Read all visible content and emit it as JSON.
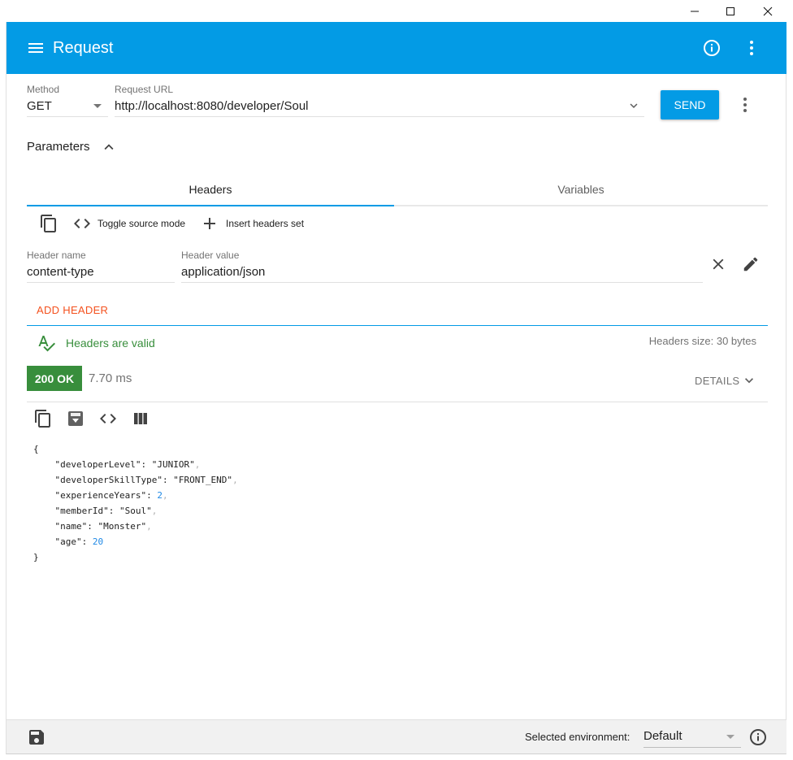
{
  "window": {
    "minimize_icon": "minimize-icon",
    "maximize_icon": "maximize-icon",
    "close_icon": "close-icon"
  },
  "appbar": {
    "title": "Request",
    "bg_color": "#039be5"
  },
  "request": {
    "method_label": "Method",
    "method_value": "GET",
    "url_label": "Request URL",
    "url_value": "http://localhost:8080/developer/Soul",
    "send_label": "SEND"
  },
  "parameters": {
    "label": "Parameters",
    "tabs": [
      {
        "label": "Headers",
        "selected": true
      },
      {
        "label": "Variables",
        "selected": false
      }
    ],
    "toolbar": {
      "toggle_source": "Toggle source mode",
      "insert_headers": "Insert headers set"
    },
    "header": {
      "name_label": "Header name",
      "name_value": "content-type",
      "value_label": "Header value",
      "value_value": "application/json"
    },
    "add_header_label": "ADD HEADER",
    "valid_text": "Headers are valid",
    "size_text": "Headers size: 30 bytes"
  },
  "response": {
    "status": "200 OK",
    "status_color": "#388e3c",
    "time": "7.70 ms",
    "details_label": "DETAILS",
    "body": {
      "open": "{",
      "close": "}",
      "entries": [
        {
          "key": "\"developerLevel\"",
          "value": "\"JUNIOR\"",
          "type": "string",
          "comma": true
        },
        {
          "key": "\"developerSkillType\"",
          "value": "\"FRONT_END\"",
          "type": "string",
          "comma": true
        },
        {
          "key": "\"experienceYears\"",
          "value": "2",
          "type": "number",
          "comma": true
        },
        {
          "key": "\"memberId\"",
          "value": "\"Soul\"",
          "type": "string",
          "comma": true
        },
        {
          "key": "\"name\"",
          "value": "\"Monster\"",
          "type": "string",
          "comma": true
        },
        {
          "key": "\"age\"",
          "value": "20",
          "type": "number",
          "comma": false
        }
      ]
    }
  },
  "footer": {
    "env_label": "Selected environment:",
    "env_value": "Default"
  }
}
